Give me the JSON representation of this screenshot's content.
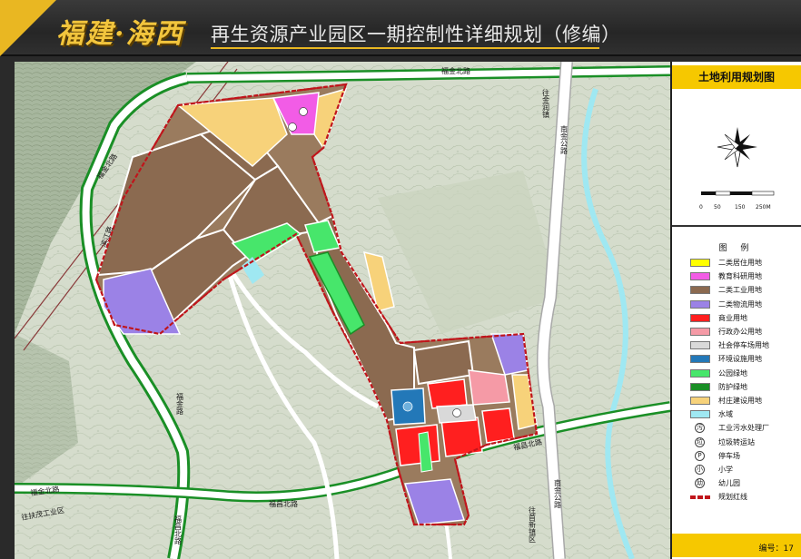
{
  "header": {
    "brand": "福建·海西",
    "title": "再生资源产业园区一期控制性详细规划（修编）"
  },
  "legend": {
    "title": "土地利用规划图",
    "heading": "图 例",
    "scale_ticks": [
      "0",
      "50",
      "150",
      "250M"
    ],
    "items": [
      {
        "label": "二类居住用地",
        "kind": "swatch",
        "color": "#ffff00"
      },
      {
        "label": "教育科研用地",
        "kind": "swatch",
        "color": "#f25ce6"
      },
      {
        "label": "二类工业用地",
        "kind": "swatch",
        "color": "#8b6a50"
      },
      {
        "label": "二类物流用地",
        "kind": "swatch",
        "color": "#9b82e6"
      },
      {
        "label": "商业用地",
        "kind": "swatch",
        "color": "#ff1f1f"
      },
      {
        "label": "行政办公用地",
        "kind": "swatch",
        "color": "#f59aa6"
      },
      {
        "label": "社会停车场用地",
        "kind": "swatch",
        "color": "#d9d9d9"
      },
      {
        "label": "环境设施用地",
        "kind": "swatch",
        "color": "#2378b8"
      },
      {
        "label": "公园绿地",
        "kind": "swatch",
        "color": "#47e66b"
      },
      {
        "label": "防护绿地",
        "kind": "swatch",
        "color": "#1a8f26"
      },
      {
        "label": "村庄建设用地",
        "kind": "swatch",
        "color": "#f7d27a"
      },
      {
        "label": "水域",
        "kind": "swatch",
        "color": "#9fe8f2"
      },
      {
        "label": "工业污水处理厂",
        "kind": "symbol",
        "glyph": "污"
      },
      {
        "label": "垃圾转运站",
        "kind": "symbol",
        "glyph": "垃"
      },
      {
        "label": "停车场",
        "kind": "symbol",
        "glyph": "P"
      },
      {
        "label": "小学",
        "kind": "symbol",
        "glyph": "小"
      },
      {
        "label": "幼儿园",
        "kind": "symbol",
        "glyph": "幼"
      },
      {
        "label": "规划红线",
        "kind": "redline"
      }
    ],
    "sheet_number": "编号：17"
  },
  "map": {
    "roads": {
      "fujin_north": "福金北路",
      "fujin_north_2": "福金北路",
      "fuchang_north": "福昌北路",
      "fuchang_north_2": "福昌北路",
      "fuchang_north_3": "福昌北路",
      "fujin_road": "福金路",
      "nanjin_road": "南金公路",
      "nanjin_road_2": "南金公路",
      "to_jinrun_town": "往金润镇",
      "to_lishan_town": "往首新镇区",
      "to_fuchang_zone": "往扶茂工业区",
      "binjiang": "滨江路"
    },
    "colors": {
      "terrain": "#d4dccb",
      "terrain_dark": "#9bb092",
      "ridge": "#8fa07f",
      "road": "#ffffff",
      "road_edge": "#a8a8a8",
      "green_belt": "#1a8f26",
      "redline": "#c0151b"
    }
  }
}
